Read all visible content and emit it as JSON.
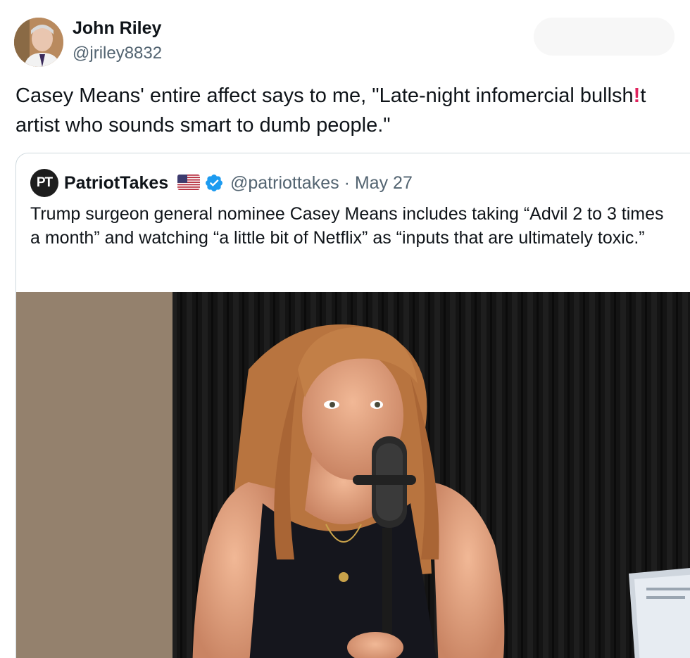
{
  "author": {
    "name": "John Riley",
    "handle": "@jriley8832"
  },
  "tweet": {
    "text_before": "Casey Means' entire affect says to me, \"Late-night infomercial bullsh",
    "text_redacted": "!",
    "text_after": "t artist who sounds smart to dumb people.\""
  },
  "quoted": {
    "avatar_initials": "PT",
    "name": "PatriotTakes",
    "handle": "@patriottakes",
    "separator": "·",
    "date": "May 27",
    "text": "Trump surgeon general nominee Casey Means includes taking “Advil 2 to 3 times a month” and watching “a little bit of Netflix” as “inputs that are ultimately toxic.”"
  },
  "icons": {
    "flag": "us-flag-icon",
    "verified": "verified-badge-icon"
  },
  "colors": {
    "text_primary": "#0f1419",
    "text_secondary": "#536471",
    "verified": "#1d9bf0",
    "border": "#cfd9de",
    "redaction": "#e0245e"
  }
}
